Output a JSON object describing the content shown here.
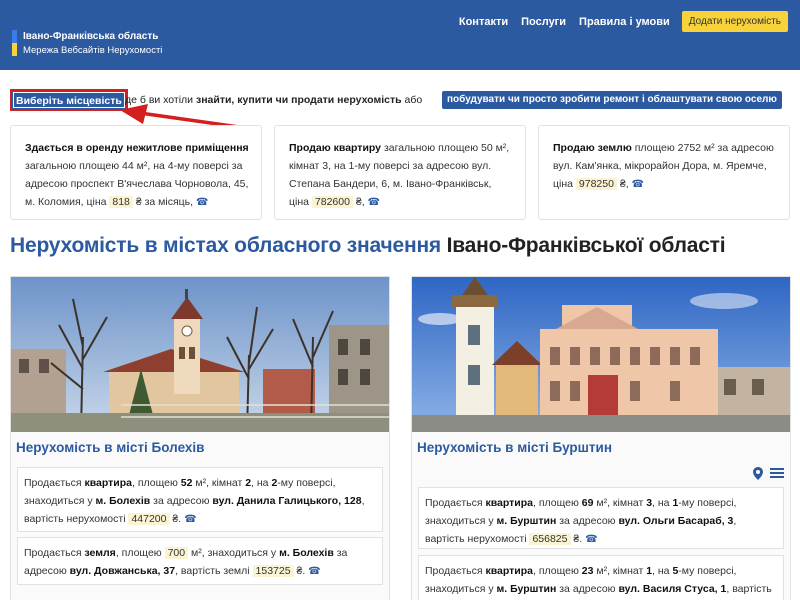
{
  "header": {
    "brand_title": "Івано-Франківська область",
    "brand_subtitle": "Мережа Вебсайтів Нерухомості",
    "nav": [
      "Контакти",
      "Послуги",
      "Правила і умови"
    ],
    "add_button": "Додати нерухомість"
  },
  "intro": {
    "location_button": "Виберіть місцевість",
    "text_prefix": "де б ви хотіли ",
    "text_bold": "знайти, купити чи продати нерухомість",
    "text_suffix": " або",
    "build_button": "побудувати чи просто зробити ремонт і облаштувати свою оселю"
  },
  "ads": [
    {
      "bold": "Здається в оренду нежитлове приміщення",
      "text": " загальною площею 44 м², на 4-му поверсі за адресою проспект В'ячеслава Чорновола, 45, м. Коломия, ціна ",
      "price": "818",
      "suffix": " ₴ за місяць,"
    },
    {
      "bold": "Продаю квартиру",
      "text": " загальною площею 50 м², кімнат 3, на 1-му поверсі за адресою вул. Степана Бандери, 6, м. Івано-Франківськ, ціна ",
      "price": "782600",
      "suffix": " ₴,"
    },
    {
      "bold": "Продаю землю",
      "text": " площею 2752 м² за адресою вул. Кам'янка, мікрорайон Дора, м. Яремче, ціна ",
      "price": "978250",
      "suffix": " ₴,"
    }
  ],
  "section": {
    "title_blue": "Нерухомість в містах обласного значення",
    "title_dark": " Івано-Франківської області"
  },
  "cities": [
    {
      "title": "Нерухомість в місті Болехів",
      "offers": [
        {
          "p1": "Продається ",
          "type": "квартира",
          "p2": ", площею ",
          "area": "52",
          "p3": " м², кімнат ",
          "rooms": "2",
          "p4": ", на ",
          "floor": "2",
          "p5": "-му поверсі, знаходиться у ",
          "city": "м. Болехів",
          "p6": " за адресою ",
          "street": "вул. Данила Галицького, 128",
          "p7": ", вартість нерухомості ",
          "price": "447200",
          "p8": " ₴."
        },
        {
          "p1": "Продається ",
          "type": "земля",
          "p2": ", площею ",
          "area": "700",
          "p3": " м², знаходиться у ",
          "city": "м. Болехів",
          "p4": " за адресою ",
          "street": "вул. Довжанська, 37",
          "p5": ", вартість землі ",
          "price": "153725",
          "p6": " ₴."
        }
      ]
    },
    {
      "title": "Нерухомість в місті Бурштин",
      "offers": [
        {
          "p1": "Продається ",
          "type": "квартира",
          "p2": ", площею ",
          "area": "69",
          "p3": " м², кімнат ",
          "rooms": "3",
          "p4": ", на ",
          "floor": "1",
          "p5": "-му поверсі, знаходиться у ",
          "city": "м. Бурштин",
          "p6": " за адресою ",
          "street": "вул. Ольги Басараб, 3",
          "p7": ", вартість нерухомості ",
          "price": "656825",
          "p8": " ₴."
        },
        {
          "p1": "Продається ",
          "type": "квартира",
          "p2": ", площею ",
          "area": "23",
          "p3": " м², кімнат ",
          "rooms": "1",
          "p4": ", на ",
          "floor": "5",
          "p5": "-му поверсі, знаходиться у ",
          "city": "м. Бурштин",
          "p6": " за адресою ",
          "street": "вул. Василя Стуса, 1",
          "p7": ", вартість"
        }
      ]
    }
  ]
}
